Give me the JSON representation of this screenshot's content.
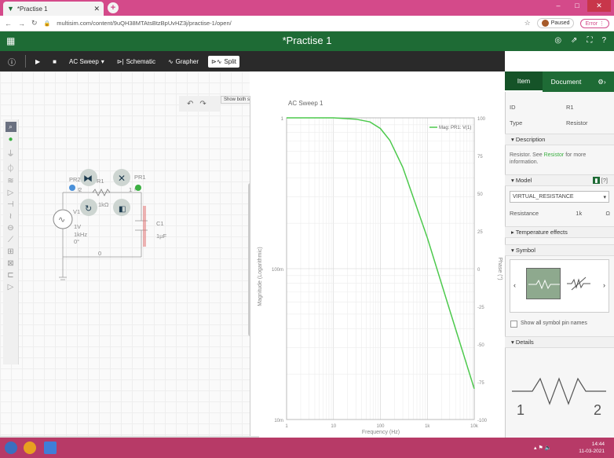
{
  "browser": {
    "tab_title": "*Practise 1",
    "url": "multisim.com/content/9uQH38MTAtsBtzBpUvHZ3j/practise-1/open/",
    "paused_label": "Paused",
    "error_label": "Error"
  },
  "app": {
    "title": "*Practise 1"
  },
  "toolbar": {
    "analysis": "AC Sweep",
    "schematic": "Schematic",
    "grapher": "Grapher",
    "split": "Split",
    "tooltip": "Show both schematic and grapher (Ctrl+E to switch view)"
  },
  "schematic": {
    "pr2": "PR2",
    "pr1": "PR1",
    "r1": "R1",
    "r1_value": "1kΩ",
    "v1": "V1",
    "v1_amp": "1V",
    "v1_freq": "1kHz",
    "v1_phase": "0°",
    "c1": "C1",
    "c1_value": "1µF",
    "node2": "2",
    "node1": "1",
    "node0": "0"
  },
  "graph": {
    "title": "AC Sweep 1",
    "legend": "Mag: PR1: V(1)",
    "xlabel": "Frequency (Hz)",
    "ylabel_left": "Magnitude (Logarithmic)",
    "ylabel_right": "Phase (°)",
    "left_ticks": [
      "1",
      "100m",
      "10m"
    ],
    "right_ticks": [
      "100",
      "75",
      "50",
      "25",
      "0",
      "-25",
      "-50",
      "-75",
      "-100"
    ],
    "x_ticks": [
      "1",
      "10",
      "100",
      "1k",
      "10k"
    ],
    "series_color": "#4cc94c"
  },
  "chart_data": {
    "type": "line",
    "title": "AC Sweep 1",
    "xlabel": "Frequency (Hz)",
    "ylabel": "Magnitude (Logarithmic)",
    "xscale": "log",
    "yscale": "log",
    "xlim": [
      1,
      10000
    ],
    "ylim": [
      0.01,
      1
    ],
    "series": [
      {
        "name": "Mag: PR1: V(1)",
        "x": [
          1,
          10,
          30,
          60,
          100,
          159,
          300,
          1000,
          3000,
          10000
        ],
        "y": [
          1,
          1,
          0.98,
          0.94,
          0.85,
          0.71,
          0.47,
          0.16,
          0.053,
          0.016
        ]
      }
    ]
  },
  "panel": {
    "tab_item": "Item",
    "tab_document": "Document",
    "id_label": "ID",
    "id_value": "R1",
    "type_label": "Type",
    "type_value": "Resistor",
    "description": "Description",
    "desc_text_pre": "Resistor. See ",
    "desc_link": "Resistor",
    "desc_text_post": " for more information.",
    "model": "Model",
    "model_help": "[?]",
    "model_value": "VIRTUAL_RESISTANCE",
    "resistance_label": "Resistance",
    "resistance_value": "1k",
    "resistance_unit": "Ω",
    "temp": "Temperature effects",
    "symbol": "Symbol",
    "show_pins": "Show all symbol pin names",
    "details": "Details",
    "pin1": "1",
    "pin2": "2"
  },
  "taskbar": {
    "time": "14:44",
    "date": "11-03-2021"
  }
}
